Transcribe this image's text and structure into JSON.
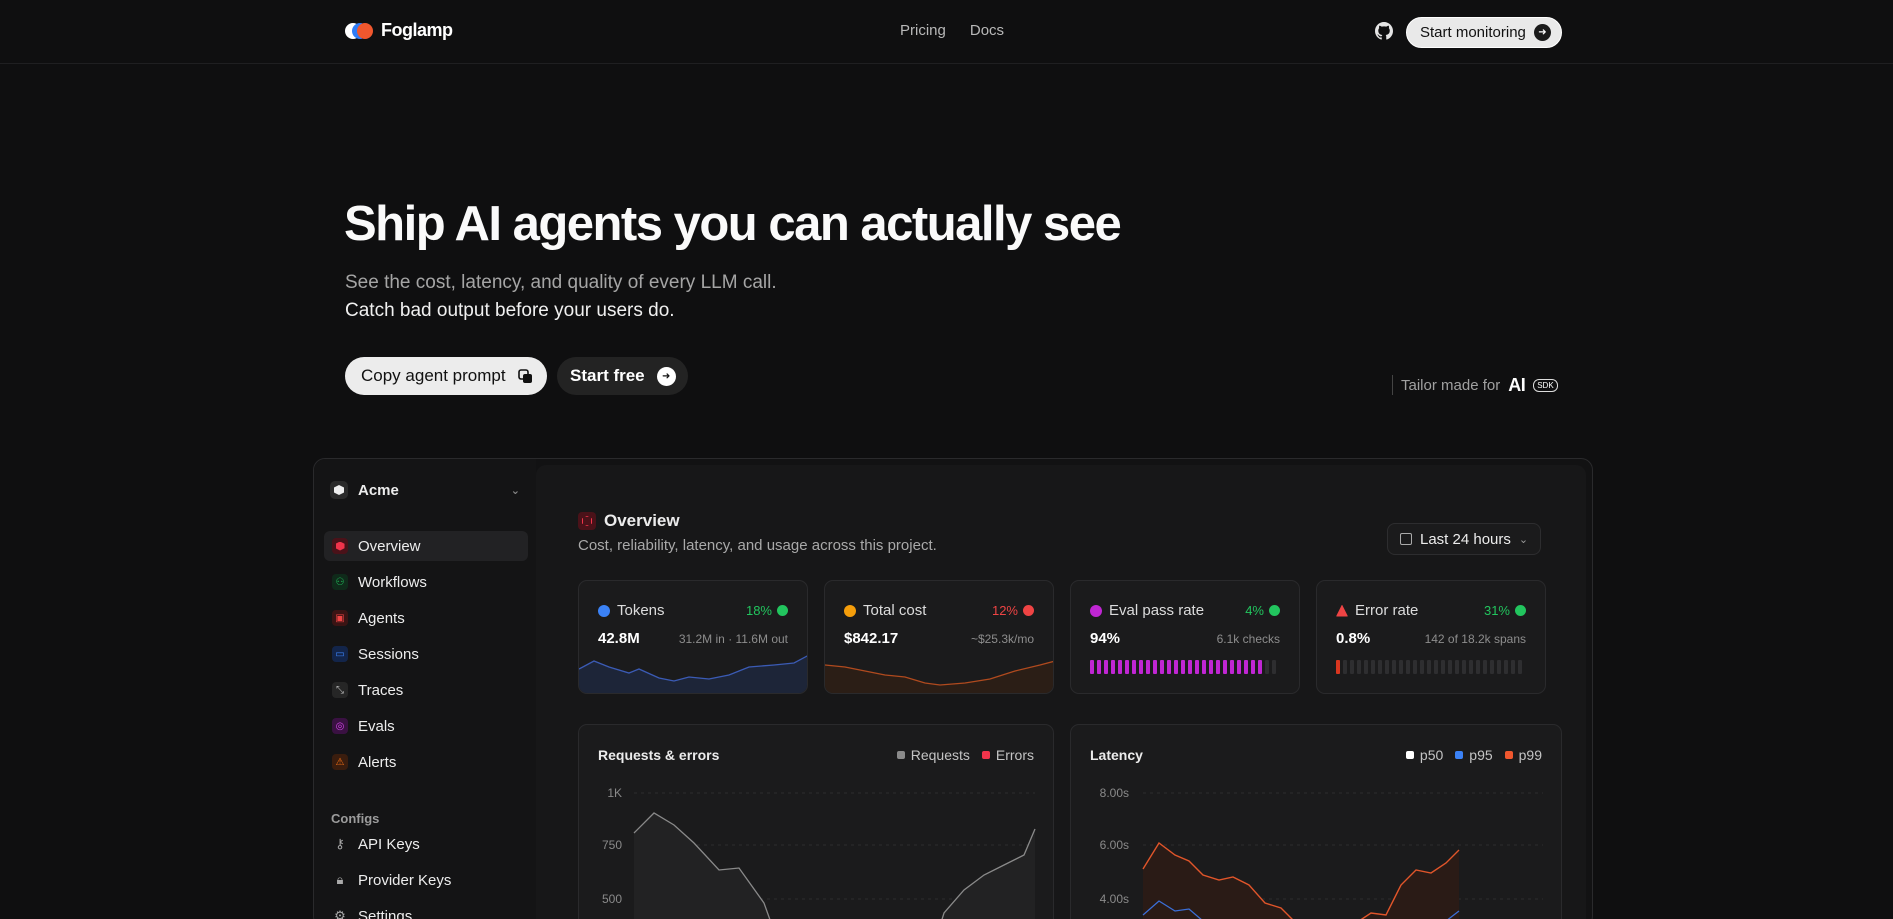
{
  "brand": {
    "name": "Foglamp"
  },
  "nav": {
    "links": [
      "Pricing",
      "Docs"
    ],
    "cta": "Start monitoring"
  },
  "hero": {
    "title": "Ship AI agents you can actually see",
    "subtitle_1": "See the cost, latency, and quality of every LLM call.",
    "subtitle_2": "Catch bad output before your users do.",
    "copy_button": "Copy agent prompt",
    "start_button": "Start free",
    "tailor_label": "Tailor made for",
    "tailor_ai": "AI",
    "tailor_sdk": "SDK"
  },
  "app": {
    "org": "Acme",
    "sidebar": [
      {
        "label": "Overview",
        "icon": "overview-icon",
        "color": "#f0344b"
      },
      {
        "label": "Workflows",
        "icon": "workflow-icon",
        "color": "#22c55e"
      },
      {
        "label": "Agents",
        "icon": "agent-icon",
        "color": "#ef4444"
      },
      {
        "label": "Sessions",
        "icon": "session-icon",
        "color": "#3b82f6"
      },
      {
        "label": "Traces",
        "icon": "trace-icon",
        "color": "#a3a3a3"
      },
      {
        "label": "Evals",
        "icon": "eval-icon",
        "color": "#c026d3"
      },
      {
        "label": "Alerts",
        "icon": "alert-icon",
        "color": "#f97316"
      }
    ],
    "configs_label": "Configs",
    "configs": [
      {
        "label": "API Keys",
        "icon": "key-icon"
      },
      {
        "label": "Provider Keys",
        "icon": "lock-icon"
      },
      {
        "label": "Settings",
        "icon": "settings-icon"
      }
    ],
    "overview": {
      "title": "Overview",
      "subtitle": "Cost, reliability, latency, and usage across this project.",
      "range": "Last 24 hours"
    },
    "stats": [
      {
        "label": "Tokens",
        "change": "18%",
        "change_color": "#22c55e",
        "value": "42.8M",
        "meta": "31.2M in · 11.6M out",
        "color": "#3b82f6"
      },
      {
        "label": "Total cost",
        "change": "12%",
        "change_color": "#ef4444",
        "value": "$842.17",
        "meta": "~$25.3k/mo",
        "color": "#f59e0b"
      },
      {
        "label": "Eval pass rate",
        "change": "4%",
        "change_color": "#22c55e",
        "value": "94%",
        "meta": "6.1k checks",
        "color": "#c026d3",
        "level": 0.94
      },
      {
        "label": "Error rate",
        "change": "31%",
        "change_color": "#22c55e",
        "value": "0.8%",
        "meta": "142 of 18.2k spans",
        "color": "#ef4444",
        "level": 0.008
      }
    ],
    "requests_panel": {
      "title": "Requests & errors",
      "legend": [
        {
          "name": "Requests",
          "color": "#8a8a8a"
        },
        {
          "name": "Errors",
          "color": "#f0344b"
        }
      ],
      "yticks": [
        "1K",
        "750",
        "500"
      ]
    },
    "latency_panel": {
      "title": "Latency",
      "legend": [
        {
          "name": "p50",
          "color": "#ffffff"
        },
        {
          "name": "p95",
          "color": "#3b82f6"
        },
        {
          "name": "p99",
          "color": "#f0572e"
        }
      ],
      "yticks": [
        "8.00s",
        "6.00s",
        "4.00s"
      ]
    }
  }
}
